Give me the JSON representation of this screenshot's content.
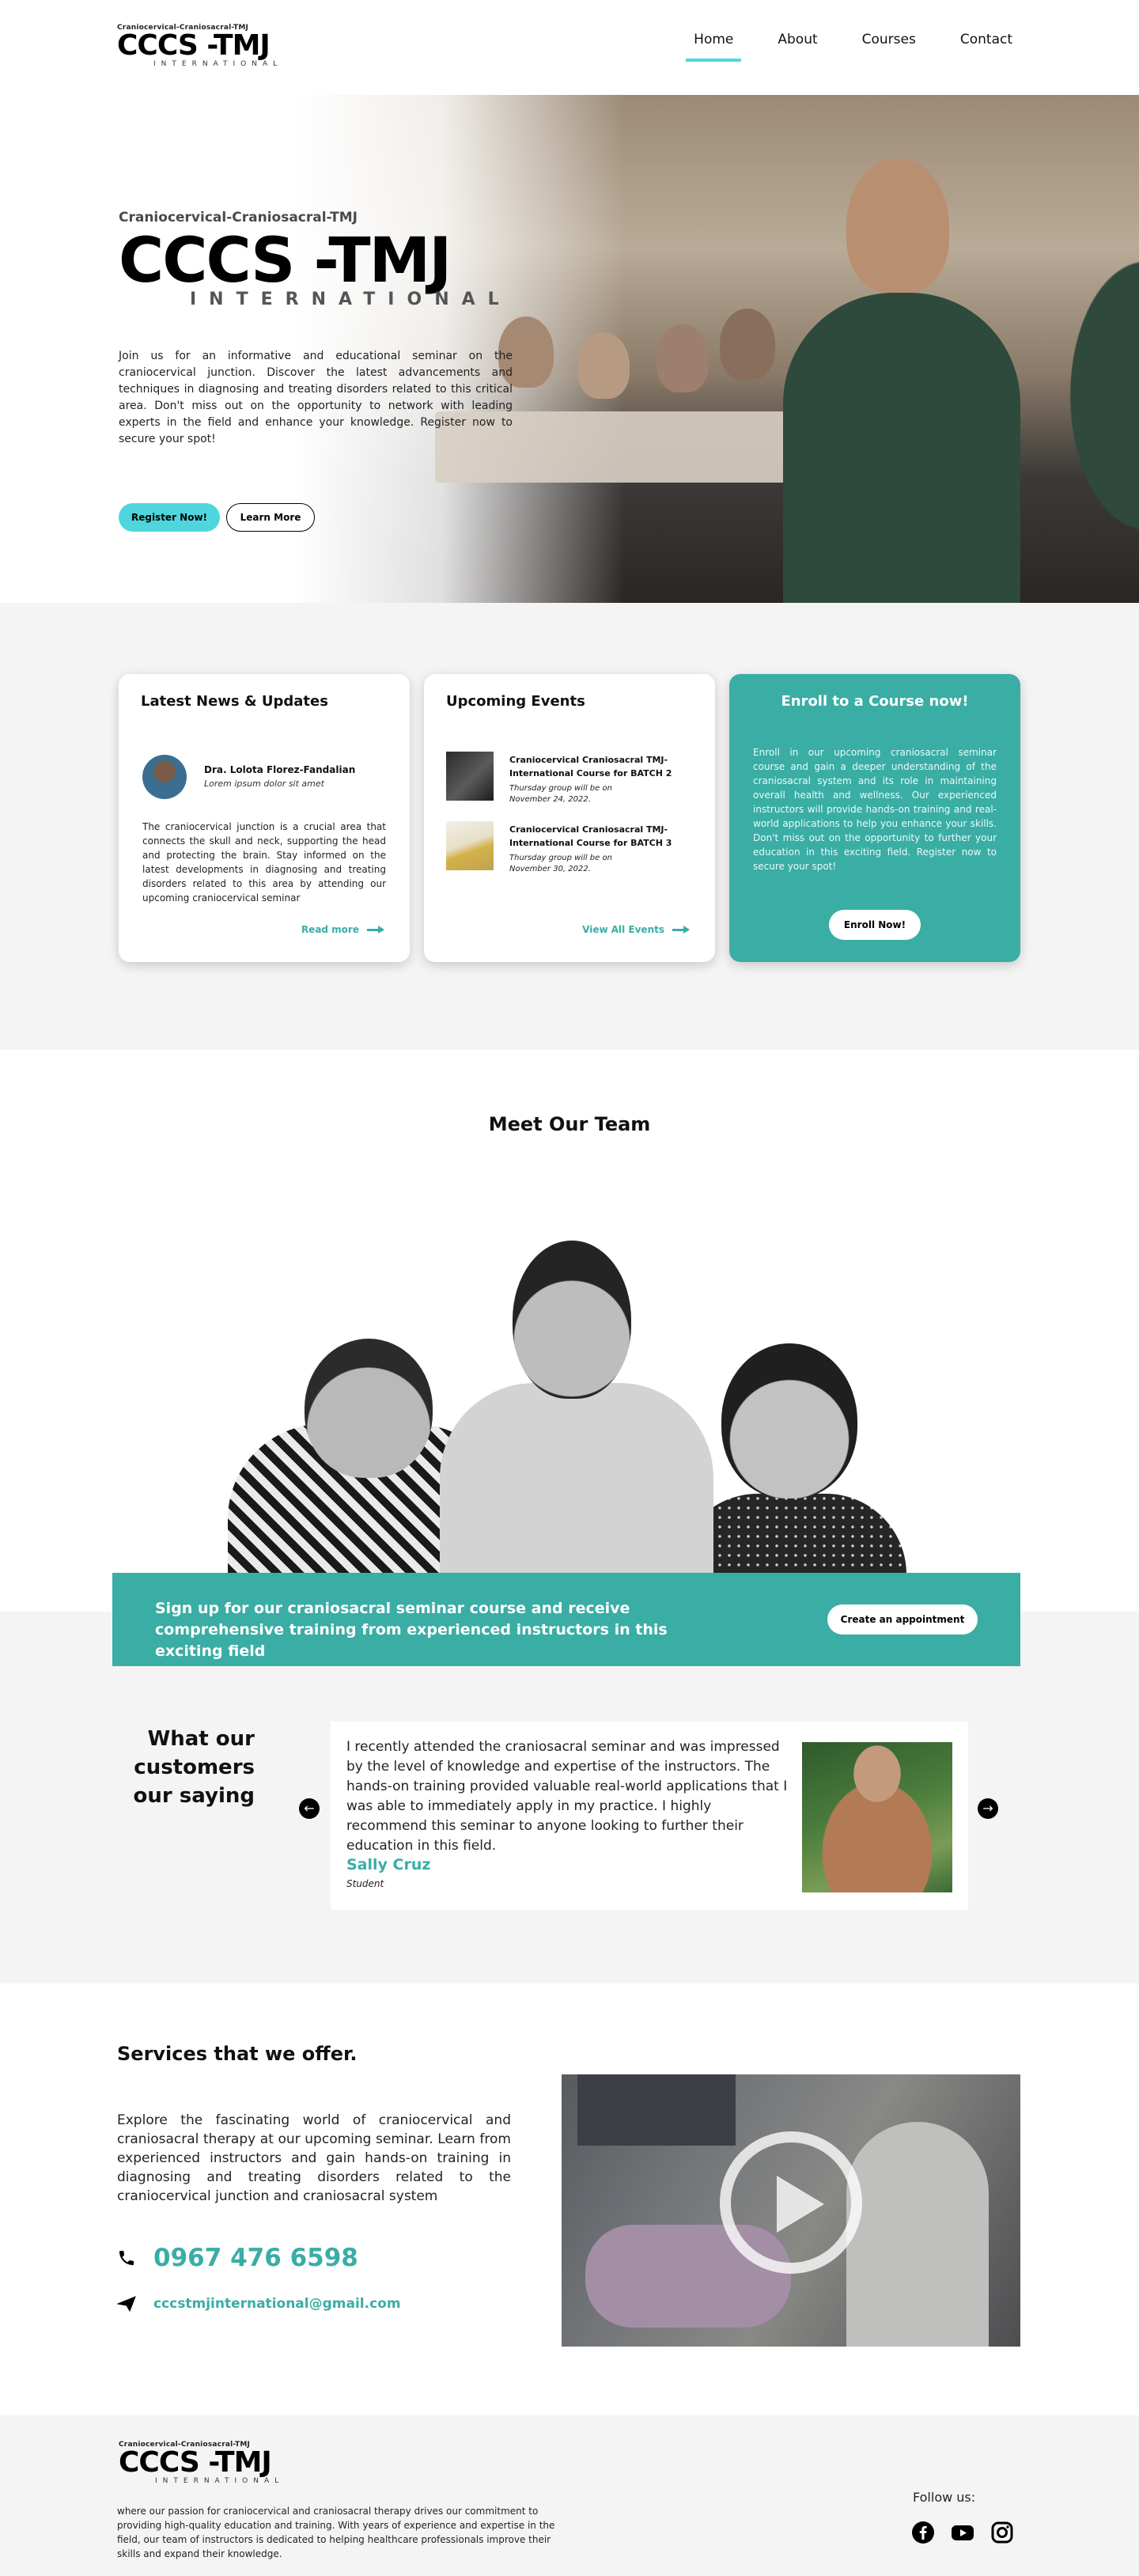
{
  "header": {
    "logo": {
      "small": "Craniocervical-Craniosacral-TMJ",
      "big": "CCCS -TMJ",
      "intl": "INTERNATIONAL"
    },
    "nav": [
      {
        "label": "Home",
        "active": true
      },
      {
        "label": "About",
        "active": false
      },
      {
        "label": "Courses",
        "active": false
      },
      {
        "label": "Contact",
        "active": false
      }
    ]
  },
  "hero": {
    "small": "Craniocervical-Craniosacral-TMJ",
    "big": "CCCS -TMJ",
    "intl": "INTERNATIONAL",
    "description": "Join us for an informative and educational seminar on the craniocervical junction. Discover the latest advancements and techniques in diagnosing and treating disorders related to this critical area. Don't miss out on the opportunity to network with leading experts in the field and enhance your knowledge. Register now to secure your spot!",
    "register_label": "Register Now!",
    "learn_label": "Learn More"
  },
  "news": {
    "title": "Latest News & Updates",
    "author": "Dra. Lolota Florez-Fandalian",
    "subtitle": "Lorem ipsum dolor sit amet",
    "body": "The craniocervical junction is a crucial area that connects the skull and neck, supporting the head and protecting the brain. Stay informed on the latest developments in diagnosing and treating disorders related to this area by attending our upcoming craniocervical seminar",
    "link": "Read more"
  },
  "events": {
    "title": "Upcoming Events",
    "items": [
      {
        "title": "Craniocervical Craniosacral TMJ-International Course for BATCH 2",
        "note1": "Thursday group will be on",
        "note2": "November 24, 2022."
      },
      {
        "title": "Craniocervical Craniosacral TMJ-International Course for BATCH 3",
        "note1": "Thursday group will be on",
        "note2": "November 30, 2022."
      }
    ],
    "link": "View All Events"
  },
  "enroll": {
    "title": "Enroll to a Course now!",
    "body": "Enroll in our upcoming craniosacral seminar course and gain a deeper understanding of the craniosacral system and its role in maintaining overall health and wellness. Our experienced instructors will provide hands-on training and real-world applications to help you enhance your skills. Don't miss out on the opportunity to further your education in this exciting field. Register now to secure your spot!",
    "button": "Enroll Now!"
  },
  "team": {
    "title": "Meet Our Team",
    "signup_text": "Sign up for our craniosacral seminar course and receive comprehensive training from experienced instructors in this exciting field",
    "appointment_label": "Create an appointment"
  },
  "testimonials": {
    "heading": "What our customers our saying",
    "quote": "I recently attended the craniosacral seminar and was impressed by the level of knowledge and expertise of the instructors. The hands-on training provided valuable real-world applications that I was able to immediately apply in my practice. I highly recommend this seminar to anyone looking to further their education in this field.",
    "name": "Sally Cruz",
    "role": "Student"
  },
  "services": {
    "title": "Services that we offer.",
    "description": "Explore the fascinating world of craniocervical and craniosacral therapy at our upcoming seminar. Learn from experienced instructors and gain hands-on training in diagnosing and treating disorders related to the craniocervical junction and craniosacral system",
    "phone": "0967 476 6598",
    "email": "cccstmjinternational@gmail.com"
  },
  "footer": {
    "logo": {
      "small": "Craniocervical-Craniosacral-TMJ",
      "big": "CCCS -TMJ",
      "intl": "INTERNATIONAL"
    },
    "description": "where our passion for craniocervical and craniosacral therapy drives our commitment to providing high-quality education and training. With years of experience and expertise in the field, our team of instructors is dedicated to helping healthcare professionals improve their skills and expand their knowledge.",
    "follow_label": "Follow us:",
    "socials": [
      "facebook-icon",
      "youtube-icon",
      "instagram-icon"
    ]
  },
  "colors": {
    "accent": "#3aada5",
    "cyan": "#4fd6dc",
    "gray_bg": "#f4f4f4"
  }
}
